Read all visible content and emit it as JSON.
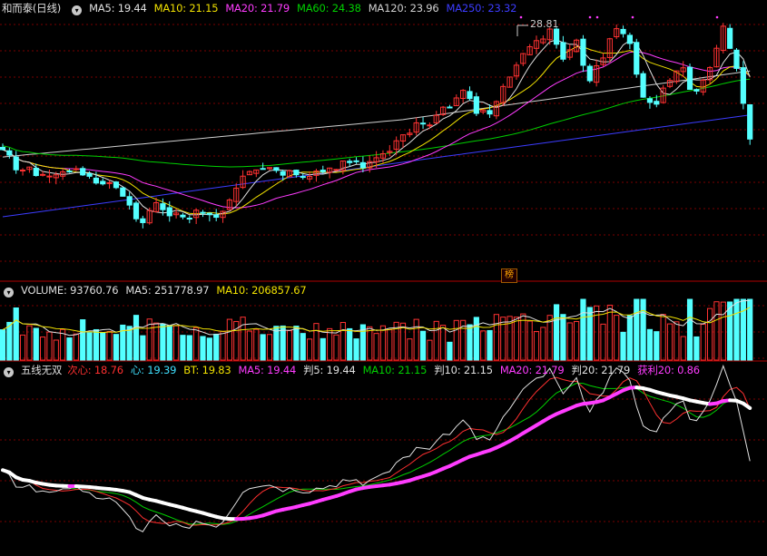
{
  "title": "和而泰(日线)",
  "main_legend": [
    {
      "label": "MA5: 19.44",
      "color": "#e0e0e0"
    },
    {
      "label": "MA10: 21.15",
      "color": "#f0e000"
    },
    {
      "label": "MA20: 21.79",
      "color": "#ff3cff"
    },
    {
      "label": "MA60: 24.38",
      "color": "#00d000"
    },
    {
      "label": "MA120: 23.96",
      "color": "#d0d0d0"
    },
    {
      "label": "MA250: 23.32",
      "color": "#3c3cff"
    }
  ],
  "high_label": "28.81",
  "badge": "榜",
  "volume_legend": [
    {
      "label": "VOLUME: 93760.76",
      "color": "#dddddd"
    },
    {
      "label": "MA5: 251778.97",
      "color": "#dddddd"
    },
    {
      "label": "MA10: 206857.67",
      "color": "#f0e000"
    }
  ],
  "indicator_title": "五线无双",
  "indicator_legend": [
    {
      "label": "次心: 18.76",
      "color": "#ff3030"
    },
    {
      "label": "心: 19.39",
      "color": "#40e0ff"
    },
    {
      "label": "BT: 19.83",
      "color": "#f0e000"
    },
    {
      "label": "MA5: 19.44",
      "color": "#ff3cff"
    },
    {
      "label": "判5: 19.44",
      "color": "#e0e0e0"
    },
    {
      "label": "MA10: 21.15",
      "color": "#00d000"
    },
    {
      "label": "判10: 21.15",
      "color": "#e0e0e0"
    },
    {
      "label": "MA20: 21.79",
      "color": "#ff3cff"
    },
    {
      "label": "判20: 21.79",
      "color": "#e0e0e0"
    },
    {
      "label": "获利20: 0.86",
      "color": "#ff3cff"
    }
  ],
  "colors": {
    "up": "#ff3232",
    "down": "#54ffff",
    "bg": "#000000",
    "grid": "#7a0000"
  },
  "chart_data": {
    "type": "candlestick",
    "close": [
      18.59,
      18.15,
      16.97,
      16.95,
      17.19,
      16.51,
      16.6,
      16.47,
      16.57,
      16.81,
      16.82,
      17.06,
      16.56,
      16.45,
      15.91,
      15.84,
      15.94,
      15.54,
      14.85,
      14.14,
      13.04,
      12.73,
      13.7,
      14.33,
      13.77,
      13.28,
      13.5,
      13.19,
      13.06,
      13.73,
      13.51,
      13.37,
      13.16,
      13.64,
      14.55,
      15.5,
      16.46,
      16.83,
      16.96,
      17.07,
      17.15,
      16.92,
      16.54,
      16.9,
      16.57,
      16.41,
      16.44,
      16.87,
      16.82,
      17.11,
      17.0,
      17.68,
      17.55,
      17.68,
      17.13,
      17.63,
      17.94,
      18.26,
      18.45,
      19.3,
      19.78,
      19.91,
      20.74,
      20.66,
      20.57,
      21.34,
      22.0,
      21.96,
      22.74,
      23.35,
      22.69,
      21.5,
      21.76,
      21.45,
      22.45,
      23.66,
      24.42,
      25.37,
      26.3,
      26.85,
      27.34,
      27.47,
      28.27,
      27.05,
      25.85,
      26.61,
      27.38,
      25.36,
      24.12,
      25.32,
      25.95,
      27.49,
      28.3,
      27.9,
      27.11,
      24.65,
      22.8,
      22.38,
      22.24,
      23.53,
      24.15,
      24.91,
      25.16,
      23.43,
      23.29,
      24.17,
      25.18,
      26.73,
      28.5,
      26.72,
      25.11,
      22.31,
      19.44
    ],
    "volume_series": [
      "VOLUME",
      "MA5",
      "MA10"
    ],
    "indicator_series": [
      "次心",
      "心",
      "BT",
      "MA5",
      "MA10",
      "MA20"
    ]
  }
}
